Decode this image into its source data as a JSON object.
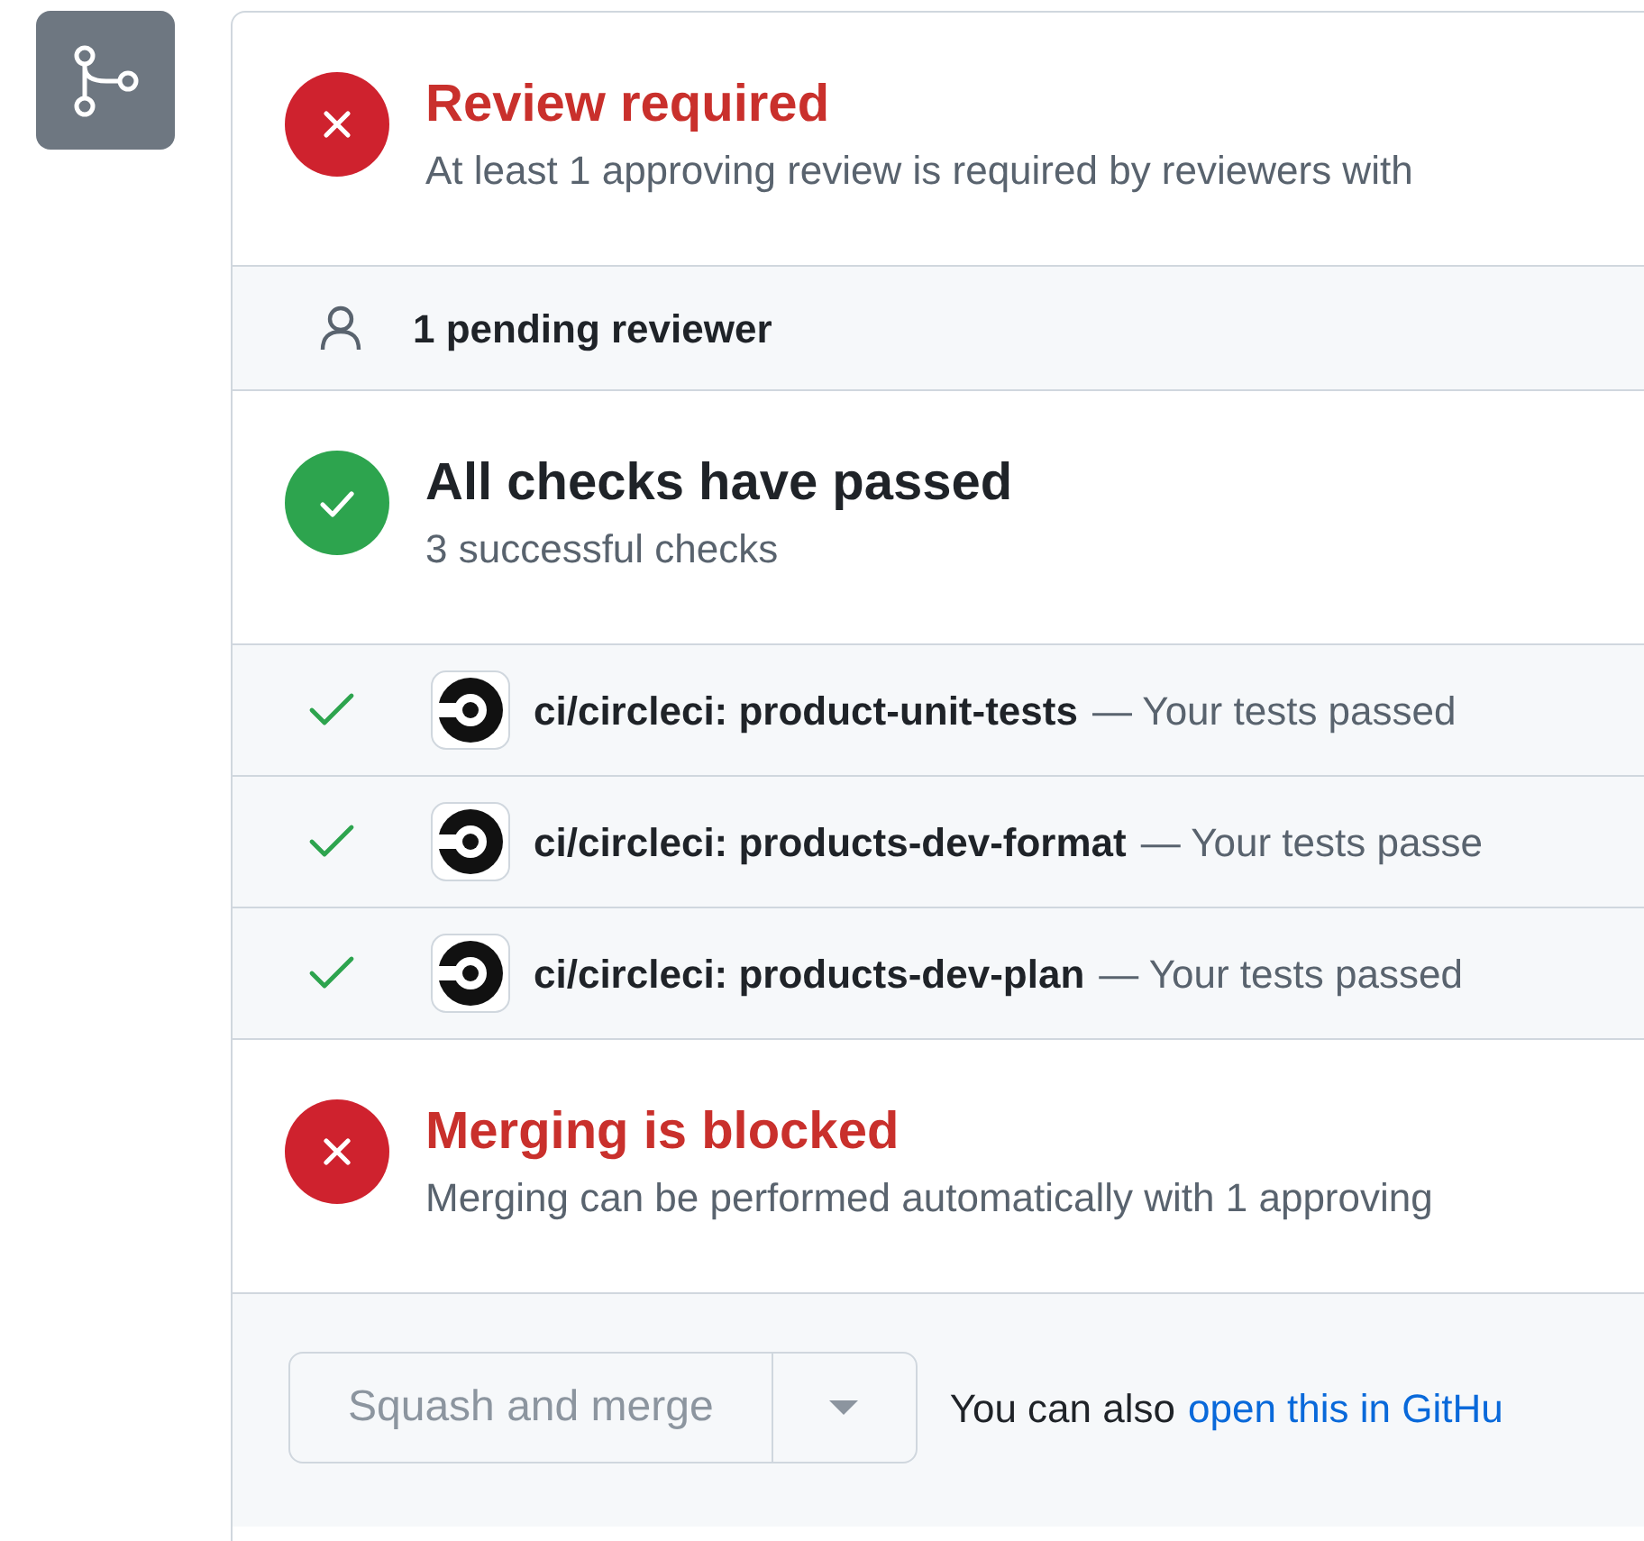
{
  "review": {
    "kind": "failure",
    "title": "Review required",
    "description": "At least 1 approving review is required by reviewers with",
    "pending": "1 pending reviewer"
  },
  "checks": {
    "kind": "success",
    "title": "All checks have passed",
    "description": "3 successful checks",
    "items": [
      {
        "name": "ci/circleci: product-unit-tests",
        "detail": "— Your tests passed",
        "passed": true
      },
      {
        "name": "ci/circleci: products-dev-format",
        "detail": "— Your tests passe",
        "passed": true
      },
      {
        "name": "ci/circleci: products-dev-plan",
        "detail": "— Your tests passed",
        "passed": true
      }
    ]
  },
  "merge": {
    "kind": "failure",
    "title": "Merging is blocked",
    "description": "Merging can be performed automatically with 1 approving"
  },
  "footer": {
    "button": "Squash and merge",
    "disabled": true,
    "note": "You can also",
    "link": "open this in GitHu"
  }
}
